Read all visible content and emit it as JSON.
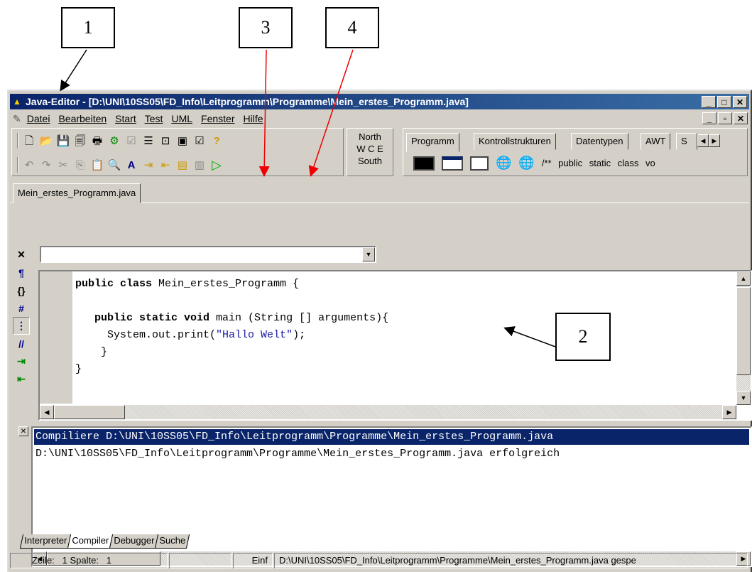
{
  "callouts": [
    "1",
    "2",
    "3",
    "4"
  ],
  "window": {
    "title": "Java-Editor - [D:\\UNI\\10SS05\\FD_Info\\Leitprogramm\\Programme\\Mein_erstes_Programm.java]",
    "caption_buttons": [
      "_",
      "□",
      "✕"
    ],
    "mdi_buttons": [
      "_",
      "▫",
      "✕"
    ]
  },
  "menu": [
    "Datei",
    "Bearbeiten",
    "Start",
    "Test",
    "UML",
    "Fenster",
    "Hilfe"
  ],
  "layout_panel": {
    "north": "North",
    "wce": "W C E",
    "south": "South"
  },
  "component_tabs": [
    "Programm",
    "Kontrollstrukturen",
    "Datentypen",
    "AWT",
    "S"
  ],
  "component_snippets": "/** public static class vo",
  "file_tab": "Mein_erstes_Programm.java",
  "code": {
    "line1_kw": "public class",
    "line1_rest": " Mein_erstes_Programm {",
    "line3_kw": "public static void",
    "line3_rest": " main (String [] arguments){",
    "line4_a": "System.out.print(",
    "line4_str": "\"Hallo Welt\"",
    "line4_b": ");",
    "line5": "}",
    "line6": "}"
  },
  "output": {
    "line1": "Compiliere D:\\UNI\\10SS05\\FD_Info\\Leitprogramm\\Programme\\Mein_erstes_Programm.java",
    "line2": "D:\\UNI\\10SS05\\FD_Info\\Leitprogramm\\Programme\\Mein_erstes_Programm.java erfolgreich"
  },
  "bottom_tabs": [
    "Interpreter",
    "Compiler",
    "Debugger",
    "Suche"
  ],
  "status": {
    "position": "Zeile:   1 Spalte:   1",
    "mode": "Einf",
    "message": "D:\\UNI\\10SS05\\FD_Info\\Leitprogramm\\Programme\\Mein_erstes_Programm.java gespe"
  }
}
